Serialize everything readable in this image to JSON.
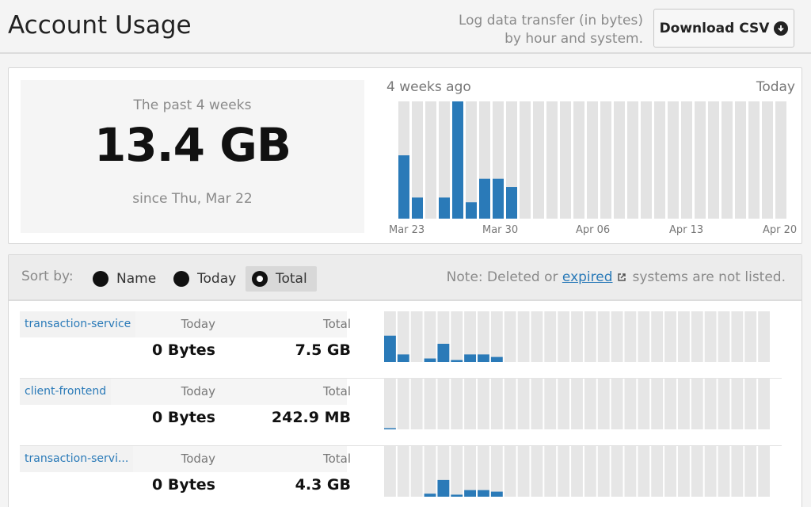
{
  "header": {
    "title": "Account Usage",
    "subtitle_line1": "Log data transfer (in bytes)",
    "subtitle_line2": "by hour and system.",
    "download_label": "Download CSV"
  },
  "summary": {
    "period_label": "The past 4 weeks",
    "total": "13.4 GB",
    "since_label": "since Thu, Mar 22",
    "range_start": "4 weeks ago",
    "range_end": "Today"
  },
  "chart_data": {
    "type": "bar",
    "title": "",
    "xlabel": "",
    "ylabel": "",
    "x_tick_labels": [
      "Mar 23",
      "Mar 30",
      "Apr 06",
      "Apr 13",
      "Apr 20"
    ],
    "values": [
      0.54,
      0.18,
      0,
      0.18,
      1.0,
      0.14,
      0.34,
      0.34,
      0.27,
      0,
      0,
      0,
      0,
      0,
      0,
      0,
      0,
      0,
      0,
      0,
      0,
      0,
      0,
      0,
      0,
      0,
      0,
      0,
      0
    ],
    "colors": {
      "bar": "#2a7ab8",
      "track": "#e3e3e3"
    }
  },
  "sort": {
    "label": "Sort by:",
    "options": [
      "Name",
      "Today",
      "Total"
    ],
    "selected": "Total"
  },
  "note": {
    "prefix": "Note: Deleted or",
    "link": "expired",
    "suffix": "systems are not listed."
  },
  "columns": {
    "today": "Today",
    "total": "Total"
  },
  "systems": [
    {
      "name": "transaction-service",
      "today": "0 Bytes",
      "total": "7.5 GB",
      "bars": [
        0.52,
        0.15,
        0,
        0.07,
        0.36,
        0.04,
        0.15,
        0.15,
        0.1,
        0,
        0,
        0,
        0,
        0,
        0,
        0,
        0,
        0,
        0,
        0,
        0,
        0,
        0,
        0,
        0,
        0,
        0,
        0,
        0
      ]
    },
    {
      "name": "client-frontend",
      "today": "0 Bytes",
      "total": "242.9 MB",
      "bars": [
        0.02,
        0,
        0,
        0,
        0,
        0,
        0,
        0,
        0,
        0,
        0,
        0,
        0,
        0,
        0,
        0,
        0,
        0,
        0,
        0,
        0,
        0,
        0,
        0,
        0,
        0,
        0,
        0,
        0
      ]
    },
    {
      "name": "transaction-servi...",
      "today": "0 Bytes",
      "total": "4.3 GB",
      "bars": [
        0,
        0,
        0,
        0.06,
        0.33,
        0.04,
        0.13,
        0.13,
        0.1,
        0,
        0,
        0,
        0,
        0,
        0,
        0,
        0,
        0,
        0,
        0,
        0,
        0,
        0,
        0,
        0,
        0,
        0,
        0,
        0
      ]
    }
  ]
}
